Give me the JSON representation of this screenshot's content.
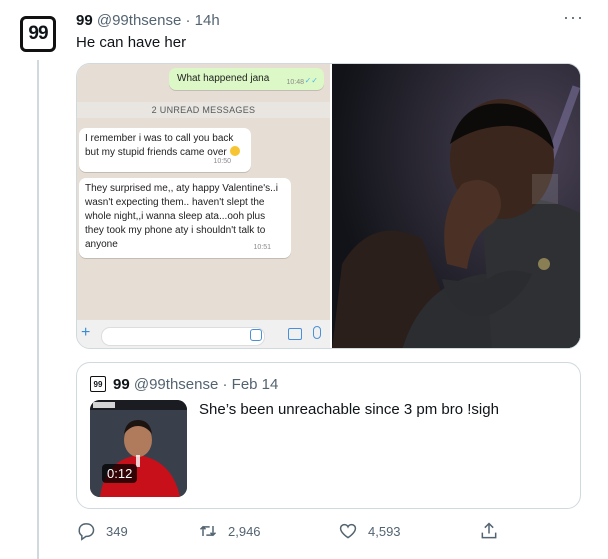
{
  "tweet": {
    "avatar_text": "99",
    "author_name": "99",
    "author_handle": "@99thsense",
    "time": "14h",
    "more_icon": "···",
    "text": "He can have her"
  },
  "chat": {
    "outgoing": {
      "text": "What happened jana",
      "time": "10:48",
      "ticks": "✓✓"
    },
    "unread_banner": "2 UNREAD MESSAGES",
    "incoming": [
      {
        "text": "I remember i was to call you back but my stupid friends came over",
        "time": "10:50"
      },
      {
        "text": "They surprised me,, aty happy Valentine's..i wasn't expecting them.. haven't slept the whole night,,i wanna sleep ata...ooh plus they took my phone aty i shouldn't talk to anyone",
        "time": "10:51"
      }
    ],
    "plus_icon": "+"
  },
  "quote": {
    "avatar_text": "99",
    "author_name": "99",
    "author_handle": "@99thsense",
    "date": "Feb 14",
    "video_duration": "0:12",
    "text": "She’s been unreachable since 3 pm bro !sigh"
  },
  "actions": {
    "reply_count": "349",
    "retweet_count": "2,946",
    "like_count": "4,593"
  },
  "colors": {
    "accent": "#1d9bf0",
    "muted": "#536471",
    "border": "#cfd9de"
  }
}
